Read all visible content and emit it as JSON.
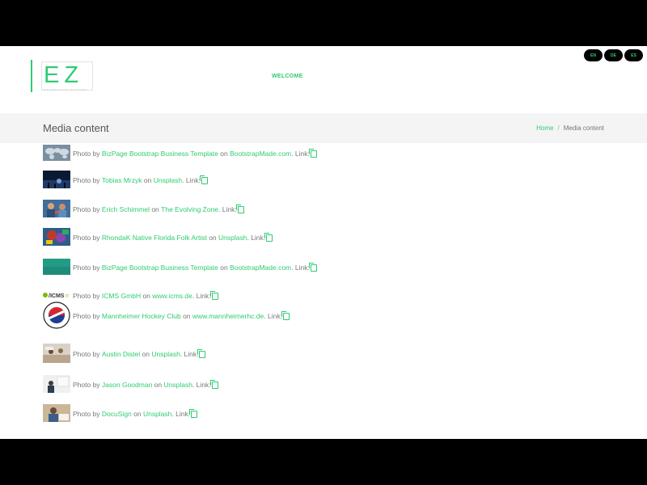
{
  "logo": {
    "letters": "EZ",
    "tagline": "INFORMATION SYSTEMS"
  },
  "nav": {
    "welcome": "WELCOME"
  },
  "languages": [
    "EN",
    "DE",
    "ES"
  ],
  "page_title": "Media content",
  "breadcrumb": {
    "home": "Home",
    "separator": "/",
    "current": "Media content"
  },
  "media_items": [
    {
      "prefix": "Photo by",
      "author": "BizPage Bootstrap Business Template",
      "on": "on",
      "source": "BootstrapMade.com",
      "suffix": ". Link:",
      "thumb": "world-map"
    },
    {
      "prefix": "Photo by",
      "author": "Tobias Mrzyk",
      "on": "on",
      "source": "Unsplash",
      "suffix": ". Link:",
      "thumb": "night-sky"
    },
    {
      "prefix": "Photo by",
      "author": "Erich Schimmel",
      "on": "on",
      "source": "The Evolving Zone",
      "suffix": ". Link:",
      "thumb": "people"
    },
    {
      "prefix": "Photo by",
      "author": "RhondaK Native Florida Folk Artist",
      "on": "on",
      "source": "Unsplash",
      "suffix": ". Link:",
      "thumb": "colorful"
    },
    {
      "prefix": "Photo by",
      "author": "BizPage Bootstrap Business Template",
      "on": "on",
      "source": "BootstrapMade.com",
      "suffix": ". Link:",
      "thumb": "teal"
    },
    {
      "prefix": "Photo by",
      "author": "ICMS GmbH",
      "on": "on",
      "source": "www.icms.de",
      "suffix": ". Link:",
      "thumb": "icms-logo"
    },
    {
      "prefix": "Photo by",
      "author": "Mannheimer Hockey Club",
      "on": "on",
      "source": "www.mannheimerhc.de",
      "suffix": ". Link:",
      "thumb": "hockey-badge"
    },
    {
      "prefix": "Photo by",
      "author": "Austin Distel",
      "on": "on",
      "source": "Unsplash",
      "suffix": ". Link:",
      "thumb": "office"
    },
    {
      "prefix": "Photo by",
      "author": "Jason Goodman",
      "on": "on",
      "source": "Unsplash",
      "suffix": ". Link:",
      "thumb": "meeting"
    },
    {
      "prefix": "Photo by",
      "author": "DocuSign",
      "on": "on",
      "source": "Unsplash",
      "suffix": ". Link:",
      "thumb": "signing"
    }
  ],
  "colors": {
    "accent": "#2ecc71",
    "text": "#777777",
    "title_bg": "#f4f4f4",
    "letterbox": "#000000"
  }
}
